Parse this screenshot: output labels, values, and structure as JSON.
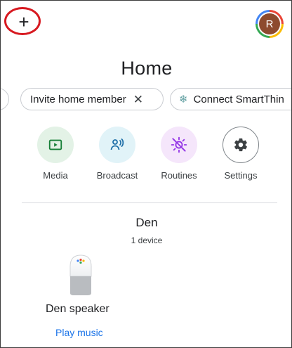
{
  "topbar": {
    "add_icon_glyph": "+",
    "add_icon": "plus-icon",
    "highlight_color": "#d71920",
    "avatar_initial": "R",
    "avatar_color": "#8d4a2e"
  },
  "page": {
    "title": "Home"
  },
  "chips": [
    {
      "label": ""
    },
    {
      "label": "Invite home member",
      "close_glyph": "✕"
    },
    {
      "label": "Connect SmartThin",
      "icon": "snowflake-icon",
      "icon_glyph": "❄"
    }
  ],
  "actions": [
    {
      "label": "Media",
      "icon": "play-icon",
      "color": "#188038"
    },
    {
      "label": "Broadcast",
      "icon": "broadcast-icon",
      "color": "#1e6fa8"
    },
    {
      "label": "Routines",
      "icon": "routines-icon",
      "color": "#9334e6"
    },
    {
      "label": "Settings",
      "icon": "gear-icon",
      "color": "#3c4043"
    }
  ],
  "room": {
    "name": "Den",
    "device_count": "1 device"
  },
  "devices": [
    {
      "name": "Den speaker",
      "action": "Play music",
      "icon": "google-home-speaker-icon"
    }
  ],
  "colors": {
    "accent_blue": "#1a73e8"
  }
}
